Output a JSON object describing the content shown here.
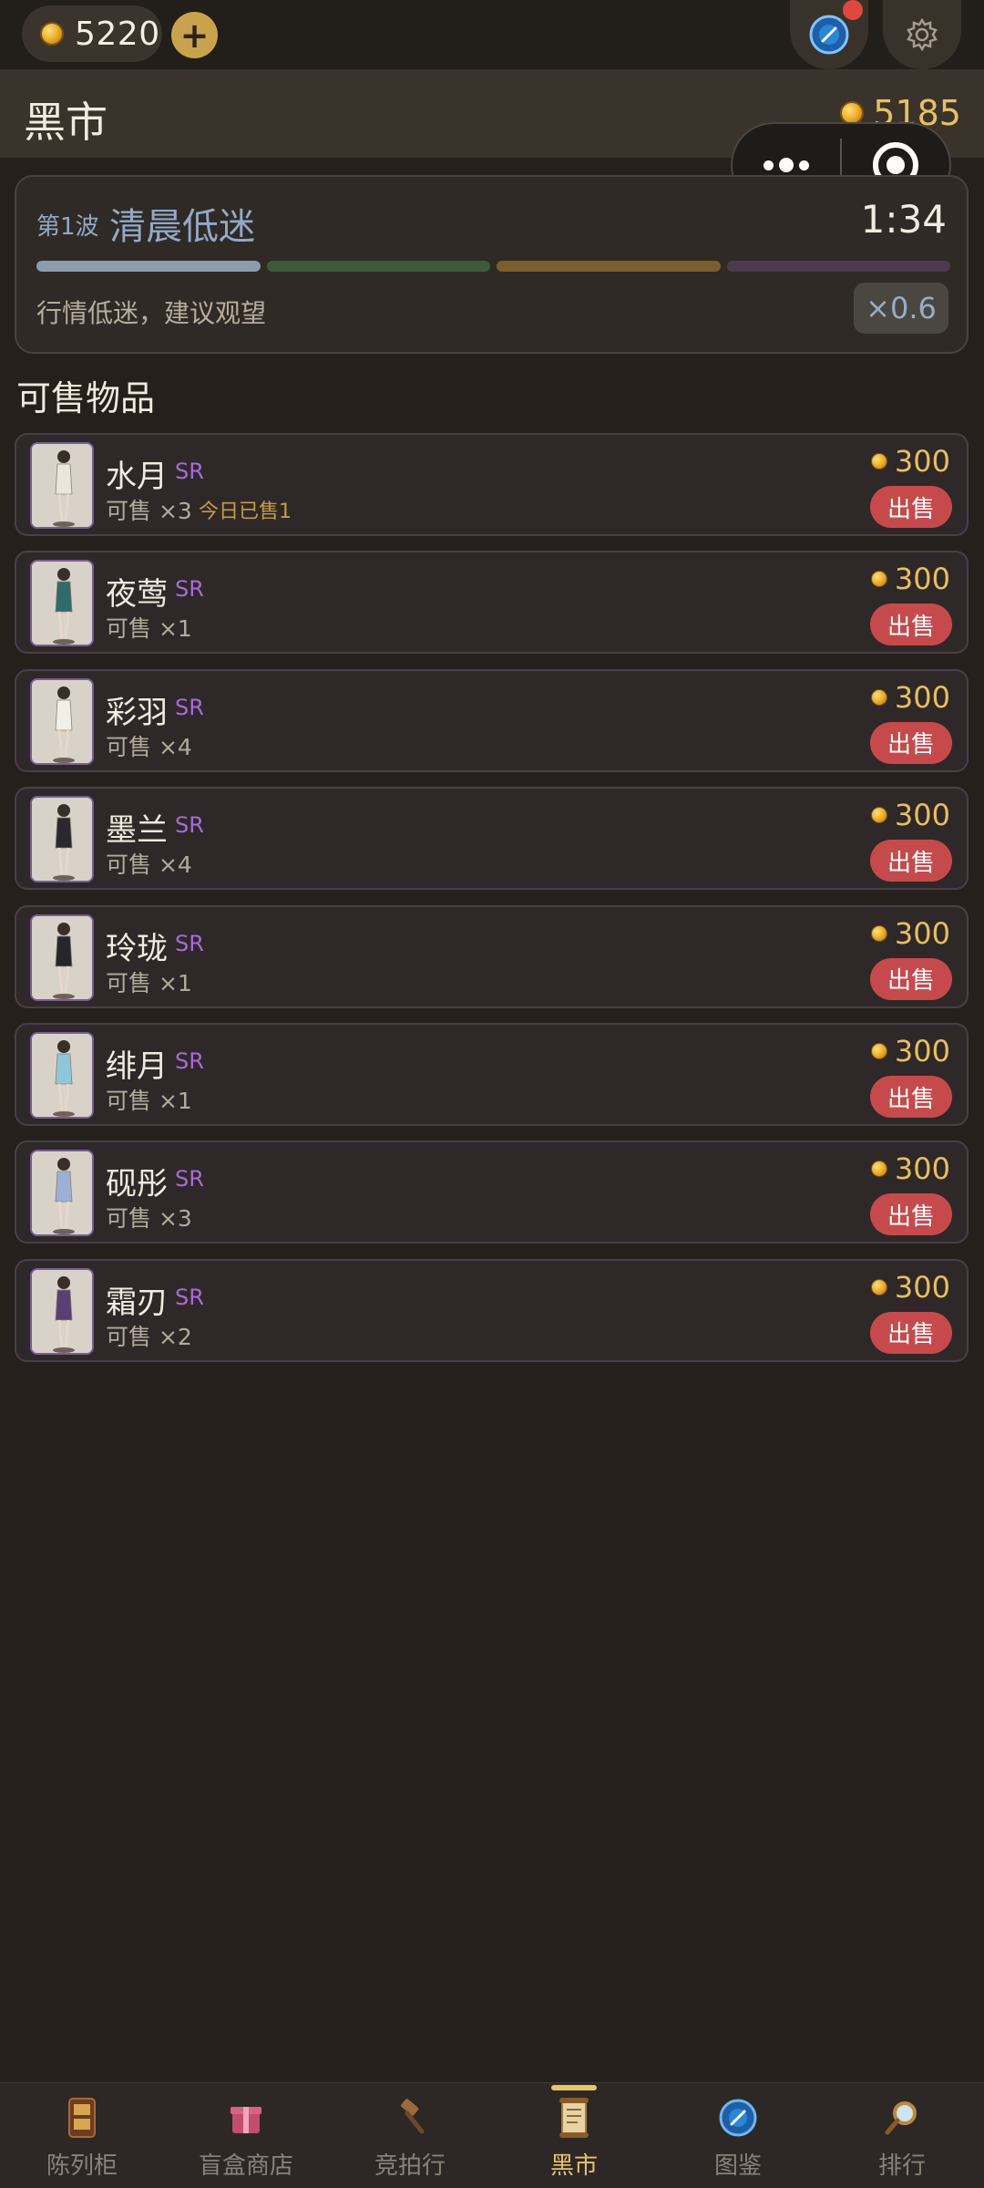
{
  "top_bar": {
    "coins": "5220",
    "add_label": "+",
    "codex_icon": "compass-orb-icon",
    "settings_icon": "gear-icon"
  },
  "header": {
    "title": "黑市",
    "balance": "5185"
  },
  "capsule": {
    "menu_icon": "more-dots-icon",
    "close_icon": "target-close-icon"
  },
  "wave": {
    "label": "第1波",
    "mood": "清晨低迷",
    "timer": "1:34",
    "advice": "行情低迷，建议观望",
    "multiplier": "×0.6",
    "phase_colors": [
      "#8d9bb0",
      "#3d5a3d",
      "#7a5e2e",
      "#4e3a4e"
    ]
  },
  "section_title": "可售物品",
  "items": [
    {
      "name": "水月",
      "rarity": "SR",
      "stock": "可售 ×3",
      "sold_today": "今日已售1",
      "price": "300",
      "sell_label": "出售",
      "outfit": "#ece6da"
    },
    {
      "name": "夜莺",
      "rarity": "SR",
      "stock": "可售 ×1",
      "sold_today": "",
      "price": "300",
      "sell_label": "出售",
      "outfit": "#2f6b6b"
    },
    {
      "name": "彩羽",
      "rarity": "SR",
      "stock": "可售 ×4",
      "sold_today": "",
      "price": "300",
      "sell_label": "出售",
      "outfit": "#f2eee8"
    },
    {
      "name": "墨兰",
      "rarity": "SR",
      "stock": "可售 ×4",
      "sold_today": "",
      "price": "300",
      "sell_label": "出售",
      "outfit": "#2a2a2e"
    },
    {
      "name": "玲珑",
      "rarity": "SR",
      "stock": "可售 ×1",
      "sold_today": "",
      "price": "300",
      "sell_label": "出售",
      "outfit": "#26262a"
    },
    {
      "name": "绯月",
      "rarity": "SR",
      "stock": "可售 ×1",
      "sold_today": "",
      "price": "300",
      "sell_label": "出售",
      "outfit": "#8fc6d8"
    },
    {
      "name": "砚彤",
      "rarity": "SR",
      "stock": "可售 ×3",
      "sold_today": "",
      "price": "300",
      "sell_label": "出售",
      "outfit": "#9bb0d4"
    },
    {
      "name": "霜刃",
      "rarity": "SR",
      "stock": "可售 ×2",
      "sold_today": "",
      "price": "300",
      "sell_label": "出售",
      "outfit": "#5a3f73"
    }
  ],
  "nav": [
    {
      "label": "陈列柜",
      "icon": "display-cabinet-icon",
      "active": false
    },
    {
      "label": "盲盒商店",
      "icon": "gift-box-icon",
      "active": false
    },
    {
      "label": "竞拍行",
      "icon": "auction-hammer-icon",
      "active": false
    },
    {
      "label": "黑市",
      "icon": "scroll-icon",
      "active": true
    },
    {
      "label": "图鉴",
      "icon": "compass-orb-icon",
      "active": false
    },
    {
      "label": "排行",
      "icon": "magnifier-icon",
      "active": false
    }
  ]
}
